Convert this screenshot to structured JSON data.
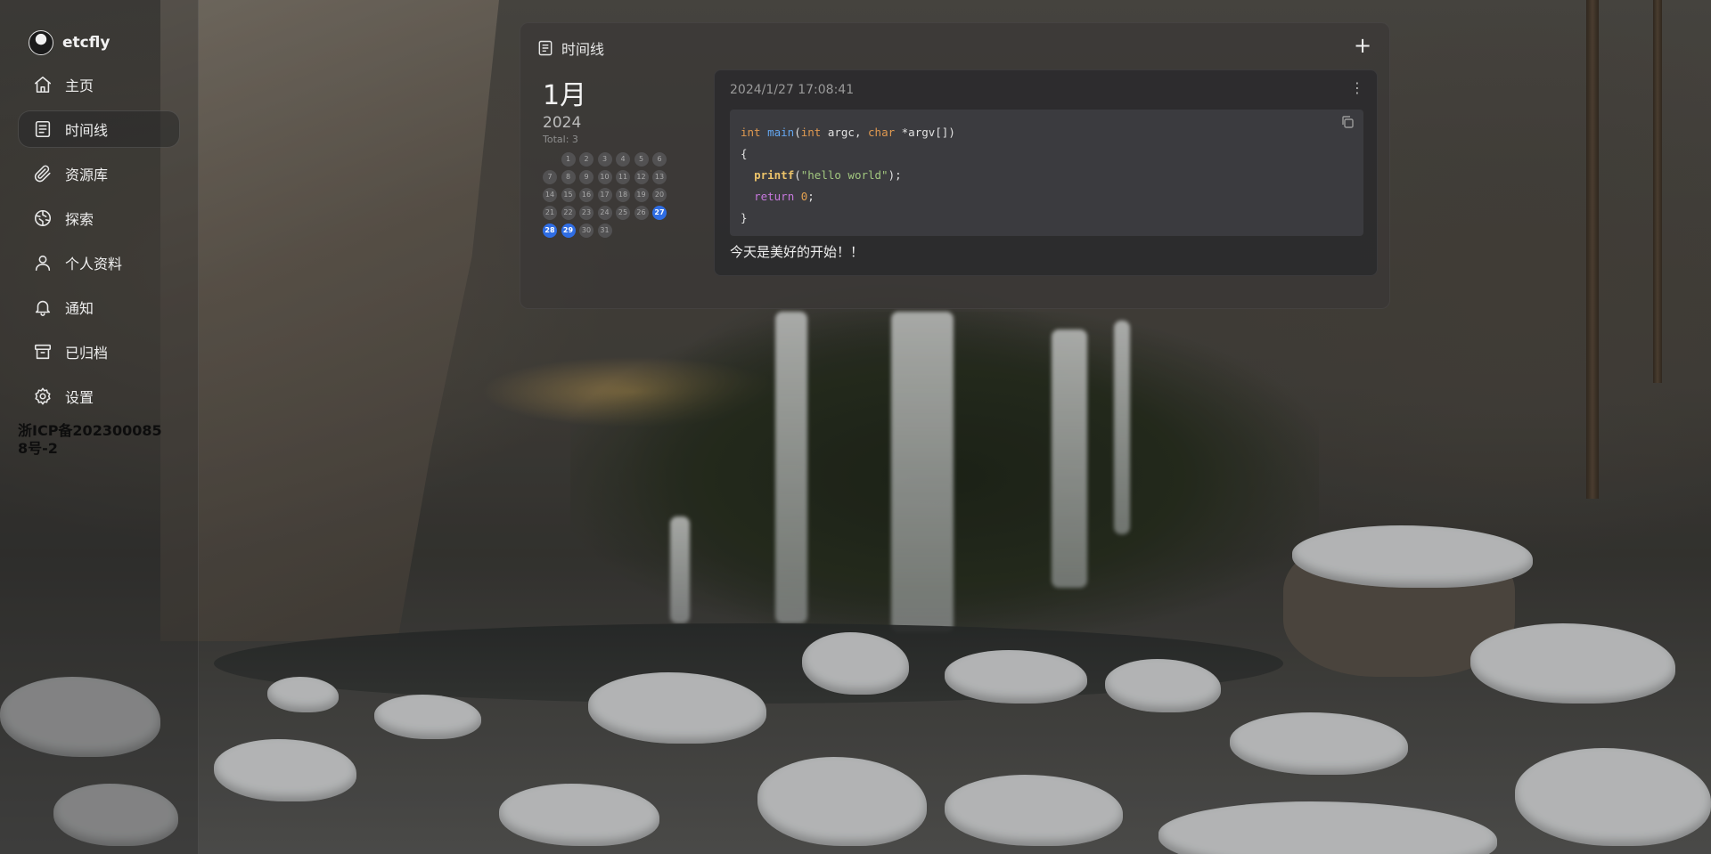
{
  "user": {
    "name": "etcfly"
  },
  "sidebar": {
    "items": [
      {
        "label": "主页",
        "icon": "home-icon"
      },
      {
        "label": "时间线",
        "icon": "timeline-icon",
        "active": true
      },
      {
        "label": "资源库",
        "icon": "paperclip-icon"
      },
      {
        "label": "探索",
        "icon": "explore-icon"
      },
      {
        "label": "个人资料",
        "icon": "user-icon"
      },
      {
        "label": "通知",
        "icon": "bell-icon"
      },
      {
        "label": "已归档",
        "icon": "archive-icon"
      },
      {
        "label": "设置",
        "icon": "gear-icon"
      }
    ],
    "icp": "浙ICP备2023000858号-2"
  },
  "timeline": {
    "title": "时间线",
    "add_label": "+"
  },
  "calendar": {
    "month": "1月",
    "year": "2024",
    "total": "Total: 3",
    "leading_blanks": 1,
    "days": 31,
    "highlighted": [
      27,
      28,
      29
    ]
  },
  "memo": {
    "timestamp": "2024/1/27 17:08:41",
    "menu": "⋮",
    "code_lines": [
      [
        [
          "kw",
          "int"
        ],
        [
          "t",
          " "
        ],
        [
          "fn",
          "main"
        ],
        [
          "t",
          "("
        ],
        [
          "kw",
          "int"
        ],
        [
          "t",
          " argc, "
        ],
        [
          "kw",
          "char"
        ],
        [
          "t",
          " *argv[])"
        ]
      ],
      [
        [
          "t",
          "{"
        ]
      ],
      [
        [
          "t",
          "  "
        ],
        [
          "pf",
          "printf"
        ],
        [
          "t",
          "("
        ],
        [
          "str",
          "\"hello world\""
        ],
        [
          "t",
          ");"
        ]
      ],
      [
        [
          "t",
          "  "
        ],
        [
          "ret",
          "return"
        ],
        [
          "t",
          " "
        ],
        [
          "num",
          "0"
        ],
        [
          "t",
          ";"
        ]
      ],
      [
        [
          "t",
          "}"
        ]
      ]
    ],
    "text": "今天是美好的开始！！"
  },
  "colors": {
    "accent": "#2f6de3",
    "keyword": "#e09950",
    "function": "#63a6f0",
    "string": "#a2c77f",
    "return": "#c678dd"
  }
}
